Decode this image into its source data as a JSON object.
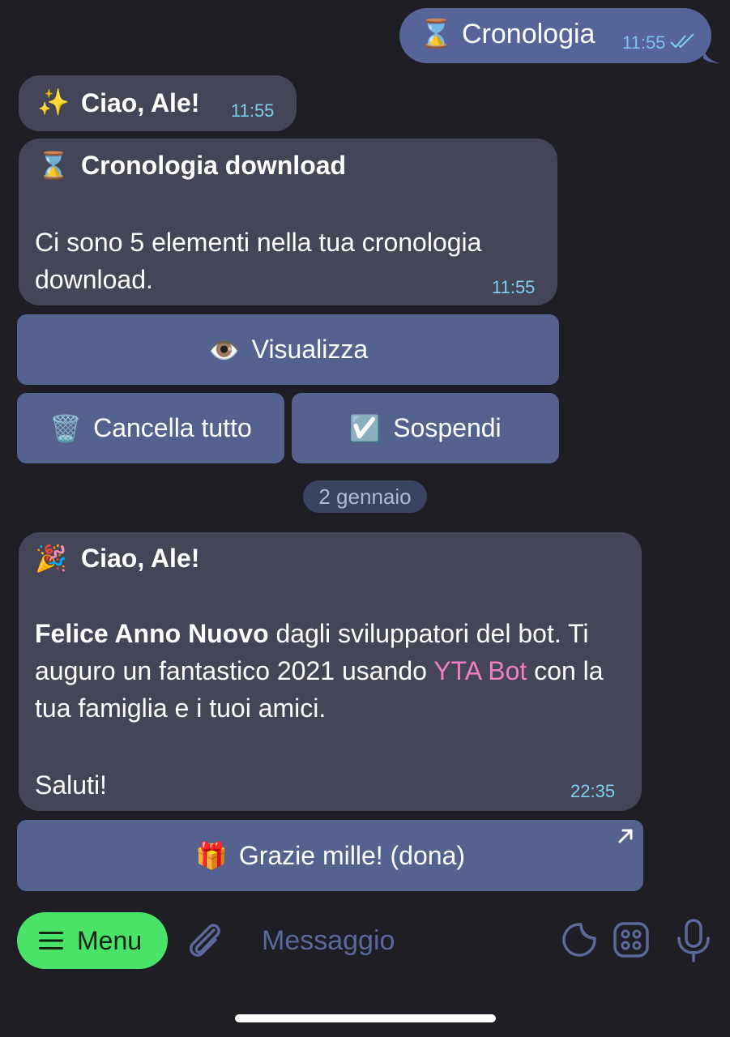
{
  "outgoing": {
    "icon": "⌛",
    "text": "Cronologia",
    "time": "11:55",
    "status_icon": "double-check-icon"
  },
  "messages": [
    {
      "icon": "✨",
      "title": "Ciao, Ale!",
      "time": "11:55"
    },
    {
      "icon": "⌛",
      "title": "Cronologia download",
      "body": "Ci sono 5 elementi nella tua cronologia download.",
      "time": "11:55"
    }
  ],
  "buttons": {
    "view": {
      "emoji": "👁️",
      "label": "Visualizza"
    },
    "clear": {
      "emoji": "🗑️",
      "label": "Cancella tutto"
    },
    "suspend": {
      "emoji": "☑️",
      "label": "Sospendi"
    }
  },
  "date_separator": "2 gennaio",
  "greeting": {
    "icon": "🎉",
    "title": "Ciao, Ale!",
    "bold_text": "Felice Anno Nuovo",
    "text_1": " dagli sviluppatori del bot. Ti auguro un fantastico 2021 usando ",
    "link_text": "YTA Bot",
    "text_2": " con la tua famiglia e i tuoi amici.",
    "signoff": "Saluti!",
    "time": "22:35"
  },
  "donate_button": {
    "emoji": "🎁",
    "label": "Grazie mille! (dona)"
  },
  "input_bar": {
    "menu_label": "Menu",
    "placeholder": "Messaggio"
  },
  "colors": {
    "background": "#1e1e24",
    "outgoing_bubble": "#56649a",
    "incoming_bubble": "#444557",
    "keyboard_button": "#55628f",
    "menu_button": "#4ae36a",
    "link": "#f07ec0",
    "timestamp": "#7ecff0"
  }
}
